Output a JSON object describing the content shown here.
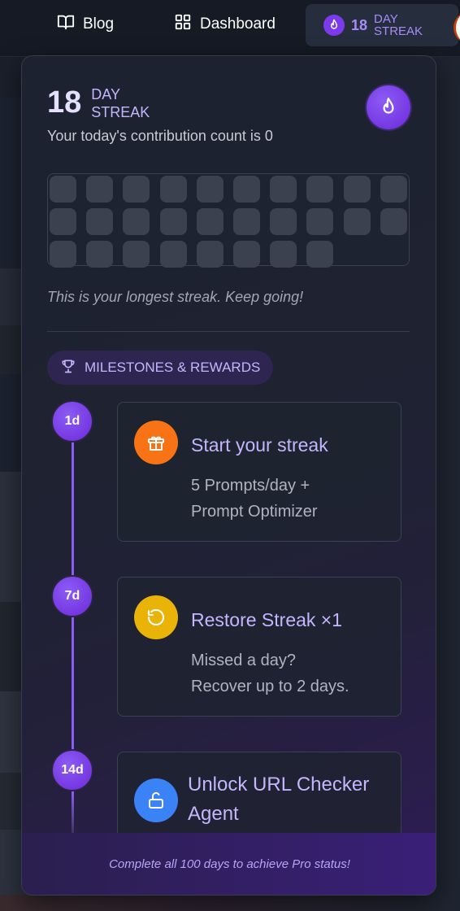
{
  "nav": {
    "blog_label": "Blog",
    "dashboard_label": "Dashboard",
    "streak_count": "18",
    "streak_label_line1": "DAY",
    "streak_label_line2": "STREAK"
  },
  "popup": {
    "streak_count": "18",
    "streak_label_line1": "DAY",
    "streak_label_line2": "STREAK",
    "contribution_text": "Your today's contribution count is 0",
    "contribution_cells_total": 28,
    "longest_text": "This is your longest streak. Keep going!",
    "milestones_label": "MILESTONES & REWARDS",
    "milestones": [
      {
        "day": "1d",
        "title": "Start your streak",
        "desc_line1": "5 Prompts/day +",
        "desc_line2": "Prompt Optimizer",
        "icon": "gift-icon",
        "icon_color": "#f97316"
      },
      {
        "day": "7d",
        "title": "Restore Streak ×1",
        "desc_line1": "Missed a day?",
        "desc_line2": "Recover up to 2 days.",
        "icon": "restore-icon",
        "icon_color": "#eab308"
      },
      {
        "day": "14d",
        "title_line1": "Unlock URL Checker",
        "title_line2": "Agent",
        "icon": "unlock-icon",
        "icon_color": "#3b82f6"
      }
    ],
    "footer_text": "Complete all 100 days to achieve Pro status!"
  },
  "colors": {
    "accent": "#8b5cf6",
    "accent_dark": "#6d28d9",
    "label_purple": "#c4b5fd",
    "cell": "#3b414e"
  }
}
